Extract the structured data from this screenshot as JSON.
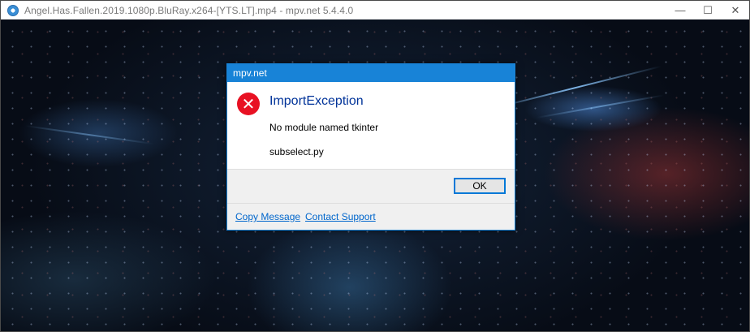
{
  "window": {
    "title": "Angel.Has.Fallen.2019.1080p.BluRay.x264-[YTS.LT].mp4 - mpv.net 5.4.4.0",
    "app_icon": "mpv-logo-icon",
    "controls": {
      "minimize_glyph": "—",
      "maximize_glyph": "☐",
      "close_glyph": "✕"
    }
  },
  "dialog": {
    "title": "mpv.net",
    "icon": "error-icon",
    "icon_glyph": "✕",
    "main_instruction": "ImportException",
    "content_lines": [
      "No module named tkinter",
      "subselect.py"
    ],
    "ok_label": "OK",
    "footer_links": [
      "Copy Message",
      "Contact Support"
    ],
    "colors": {
      "accent": "#1883d7",
      "error": "#e81123",
      "instruction": "#003399",
      "link": "#0066cc"
    }
  }
}
